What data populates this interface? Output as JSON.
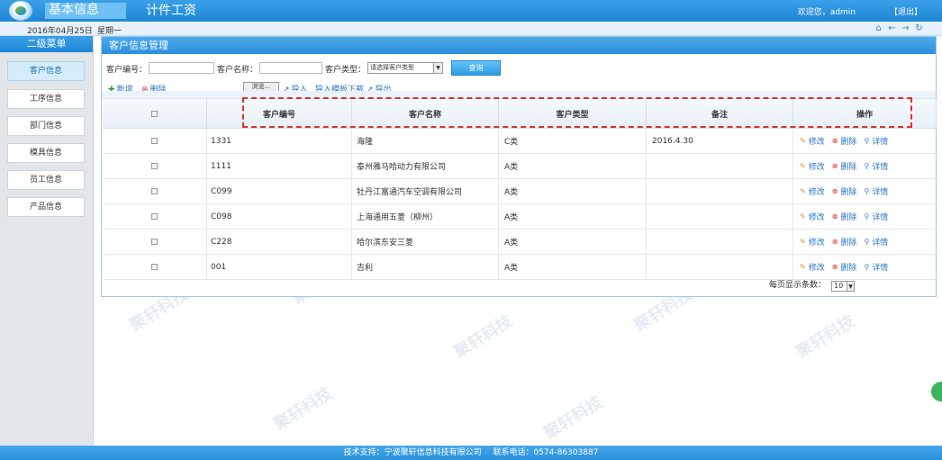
{
  "header": {
    "nav": [
      "基本信息",
      "计件工资"
    ],
    "welcome": "欢迎您，admin",
    "logout": "【退出】"
  },
  "datebar": {
    "date": "2016年04月25日",
    "weekday": "星期一",
    "icons": [
      "home-icon",
      "back-arrow-icon",
      "forward-arrow-icon",
      "refresh-icon"
    ]
  },
  "sidebar": {
    "title": "二级菜单",
    "items": [
      "客户信息",
      "工序信息",
      "部门信息",
      "模具信息",
      "员工信息",
      "产品信息"
    ],
    "active_index": 0
  },
  "main": {
    "title": "客户信息管理",
    "search": {
      "code_label": "客户编号：",
      "code_value": "",
      "name_label": "客户名称：",
      "name_value": "",
      "type_label": "客户类型：",
      "type_selected": "请选择客户类型",
      "query_label": "查询"
    },
    "toolbar": {
      "add": "新增",
      "delete": "删除",
      "browse": "浏览...",
      "import": "导入",
      "template": "导入模板下载",
      "export": "导出"
    },
    "table": {
      "headers": [
        "客户编号",
        "客户名称",
        "客户类型",
        "备注",
        "操作"
      ],
      "rows": [
        {
          "code": "1331",
          "name": "海隆",
          "type": "C类",
          "note": "2016.4.30"
        },
        {
          "code": "1111",
          "name": "泰州雅马哈动力有限公司",
          "type": "A类",
          "note": ""
        },
        {
          "code": "C099",
          "name": "牡丹江富通汽车空调有限公司",
          "type": "A类",
          "note": ""
        },
        {
          "code": "C098",
          "name": "上海通用五菱（柳州）",
          "type": "A类",
          "note": ""
        },
        {
          "code": "C228",
          "name": "哈尔滨东安三菱",
          "type": "A类",
          "note": ""
        },
        {
          "code": "001",
          "name": "吉利",
          "type": "A类",
          "note": ""
        }
      ],
      "ops": {
        "edit": "修改",
        "delete": "删除",
        "detail": "详情"
      }
    },
    "pager": {
      "label": "每页显示条数：",
      "value": "10"
    }
  },
  "footer": {
    "support": "技术支持：宁波聚轩信息科技有限公司",
    "phone": "联系电话：0574-86303887"
  },
  "watermark": "聚轩科技",
  "colors": {
    "header_blue": "#1e86d6",
    "accent_red": "#d9322a",
    "link_blue": "#2a75c4"
  }
}
